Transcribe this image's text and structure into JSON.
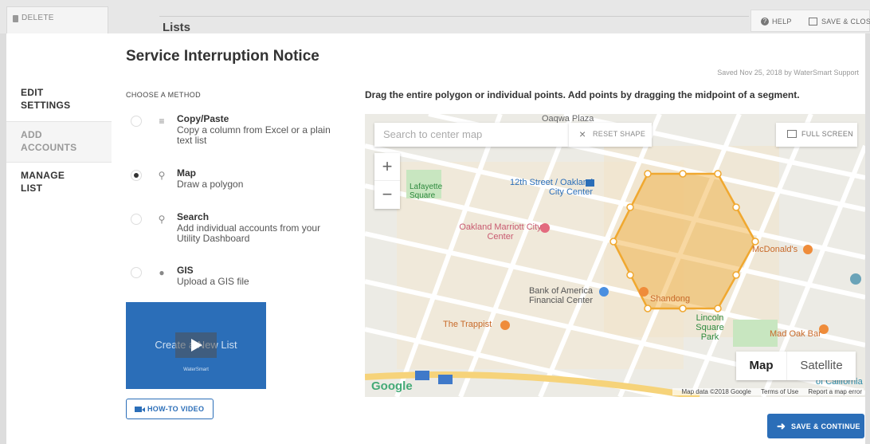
{
  "background": {
    "delete_label": "DELETE",
    "page_title": "Lists",
    "help_label": "HELP",
    "save_close_label": "SAVE & CLOS"
  },
  "modal": {
    "title": "Service Interruption Notice",
    "saved_text": "Saved Nov 25, 2018 by WaterSmart Support",
    "nav": [
      {
        "label": "EDIT\nSETTINGS"
      },
      {
        "label": "ADD\nACCOUNTS"
      },
      {
        "label": "MANAGE\nLIST"
      }
    ],
    "choose_label": "CHOOSE A METHOD",
    "methods": [
      {
        "title": "Copy/Paste",
        "desc": "Copy a column from Excel or a plain text list",
        "icon": "list-icon",
        "selected": false
      },
      {
        "title": "Map",
        "desc": "Draw a polygon",
        "icon": "map-person-icon",
        "selected": true
      },
      {
        "title": "Search",
        "desc": "Add individual accounts from your Utility Dashboard",
        "icon": "search-icon",
        "selected": false
      },
      {
        "title": "GIS",
        "desc": "Upload a GIS file",
        "icon": "location-pin-icon",
        "selected": false
      }
    ],
    "video": {
      "text": "Create a New List",
      "logo": "WaterSmart"
    },
    "howto_label": "HOW-TO VIDEO",
    "instructions": "Drag the entire polygon or individual points. Add points by dragging the midpoint of a segment.",
    "map": {
      "search_placeholder": "Search to center map",
      "reset_label": "RESET SHAPE",
      "fullscreen_label": "FULL SCREEN",
      "zoom_in": "+",
      "zoom_out": "−",
      "type_map": "Map",
      "type_satellite": "Satellite",
      "google": "Google",
      "attribution": "Map data ©2018 Google",
      "terms": "Terms of Use",
      "report": "Report a map error",
      "labels": [
        "Oakland Marriott City Center",
        "12th Street / Oakland City Center",
        "Lafayette Square",
        "Bank of America Financial Center",
        "The Trappist",
        "Shandong",
        "McDonald's",
        "Mad Oak Bar",
        "Lincoln Square Park",
        "Oaqwa Plaza",
        "of California"
      ],
      "polygon_color": "#f0a830"
    },
    "save_label": "SAVE & CONTINUE"
  }
}
